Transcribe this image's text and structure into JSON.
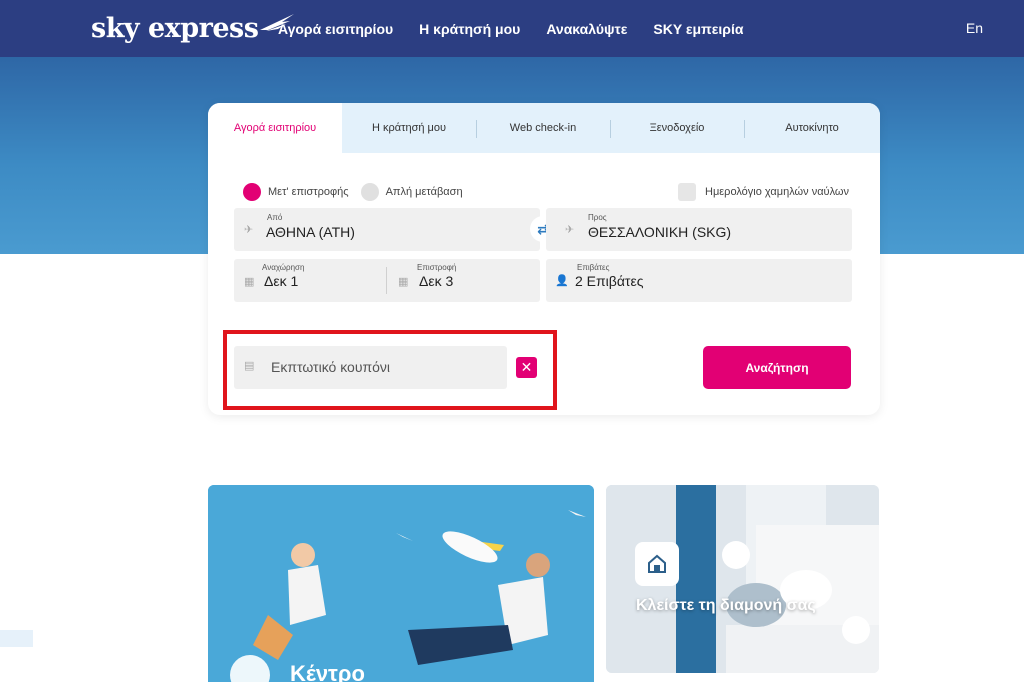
{
  "header": {
    "logo_text": "sky express",
    "nav": [
      "Αγορά εισιτηρίου",
      "Η κράτησή μου",
      "Ανακαλύψτε",
      "SKY εμπειρία"
    ],
    "lang": "En"
  },
  "booking": {
    "tabs": [
      "Αγορά εισιτηρίου",
      "Η κράτησή μου",
      "Web check-in",
      "Ξενοδοχείο",
      "Αυτοκίνητο"
    ],
    "trip_types": [
      "Μετ' επιστροφής",
      "Απλή μετάβαση"
    ],
    "low_fare_calendar": "Ημερολόγιο χαμηλών ναύλων",
    "from": {
      "label": "Από",
      "value": "ΑΘΗΝΑ (ATH)"
    },
    "to": {
      "label": "Προς",
      "value": "ΘΕΣΣΑΛΟΝΙΚΗ (SKG)"
    },
    "departure": {
      "label": "Αναχώρηση",
      "value": "Δεκ 1"
    },
    "return": {
      "label": "Επιστροφή",
      "value": "Δεκ 3"
    },
    "passengers": {
      "label": "Επιβάτες",
      "value": "2 Επιβάτες"
    },
    "coupon_placeholder": "Εκπτωτικό κουπόνι",
    "search_label": "Αναζήτηση"
  },
  "promos": {
    "hotel_title": "Κλείστε τη διαμονή σας",
    "left_title": "Κέντρο"
  },
  "colors": {
    "brand_navy": "#2c3e82",
    "accent_pink": "#e20074",
    "highlight_red": "#e0151c"
  }
}
